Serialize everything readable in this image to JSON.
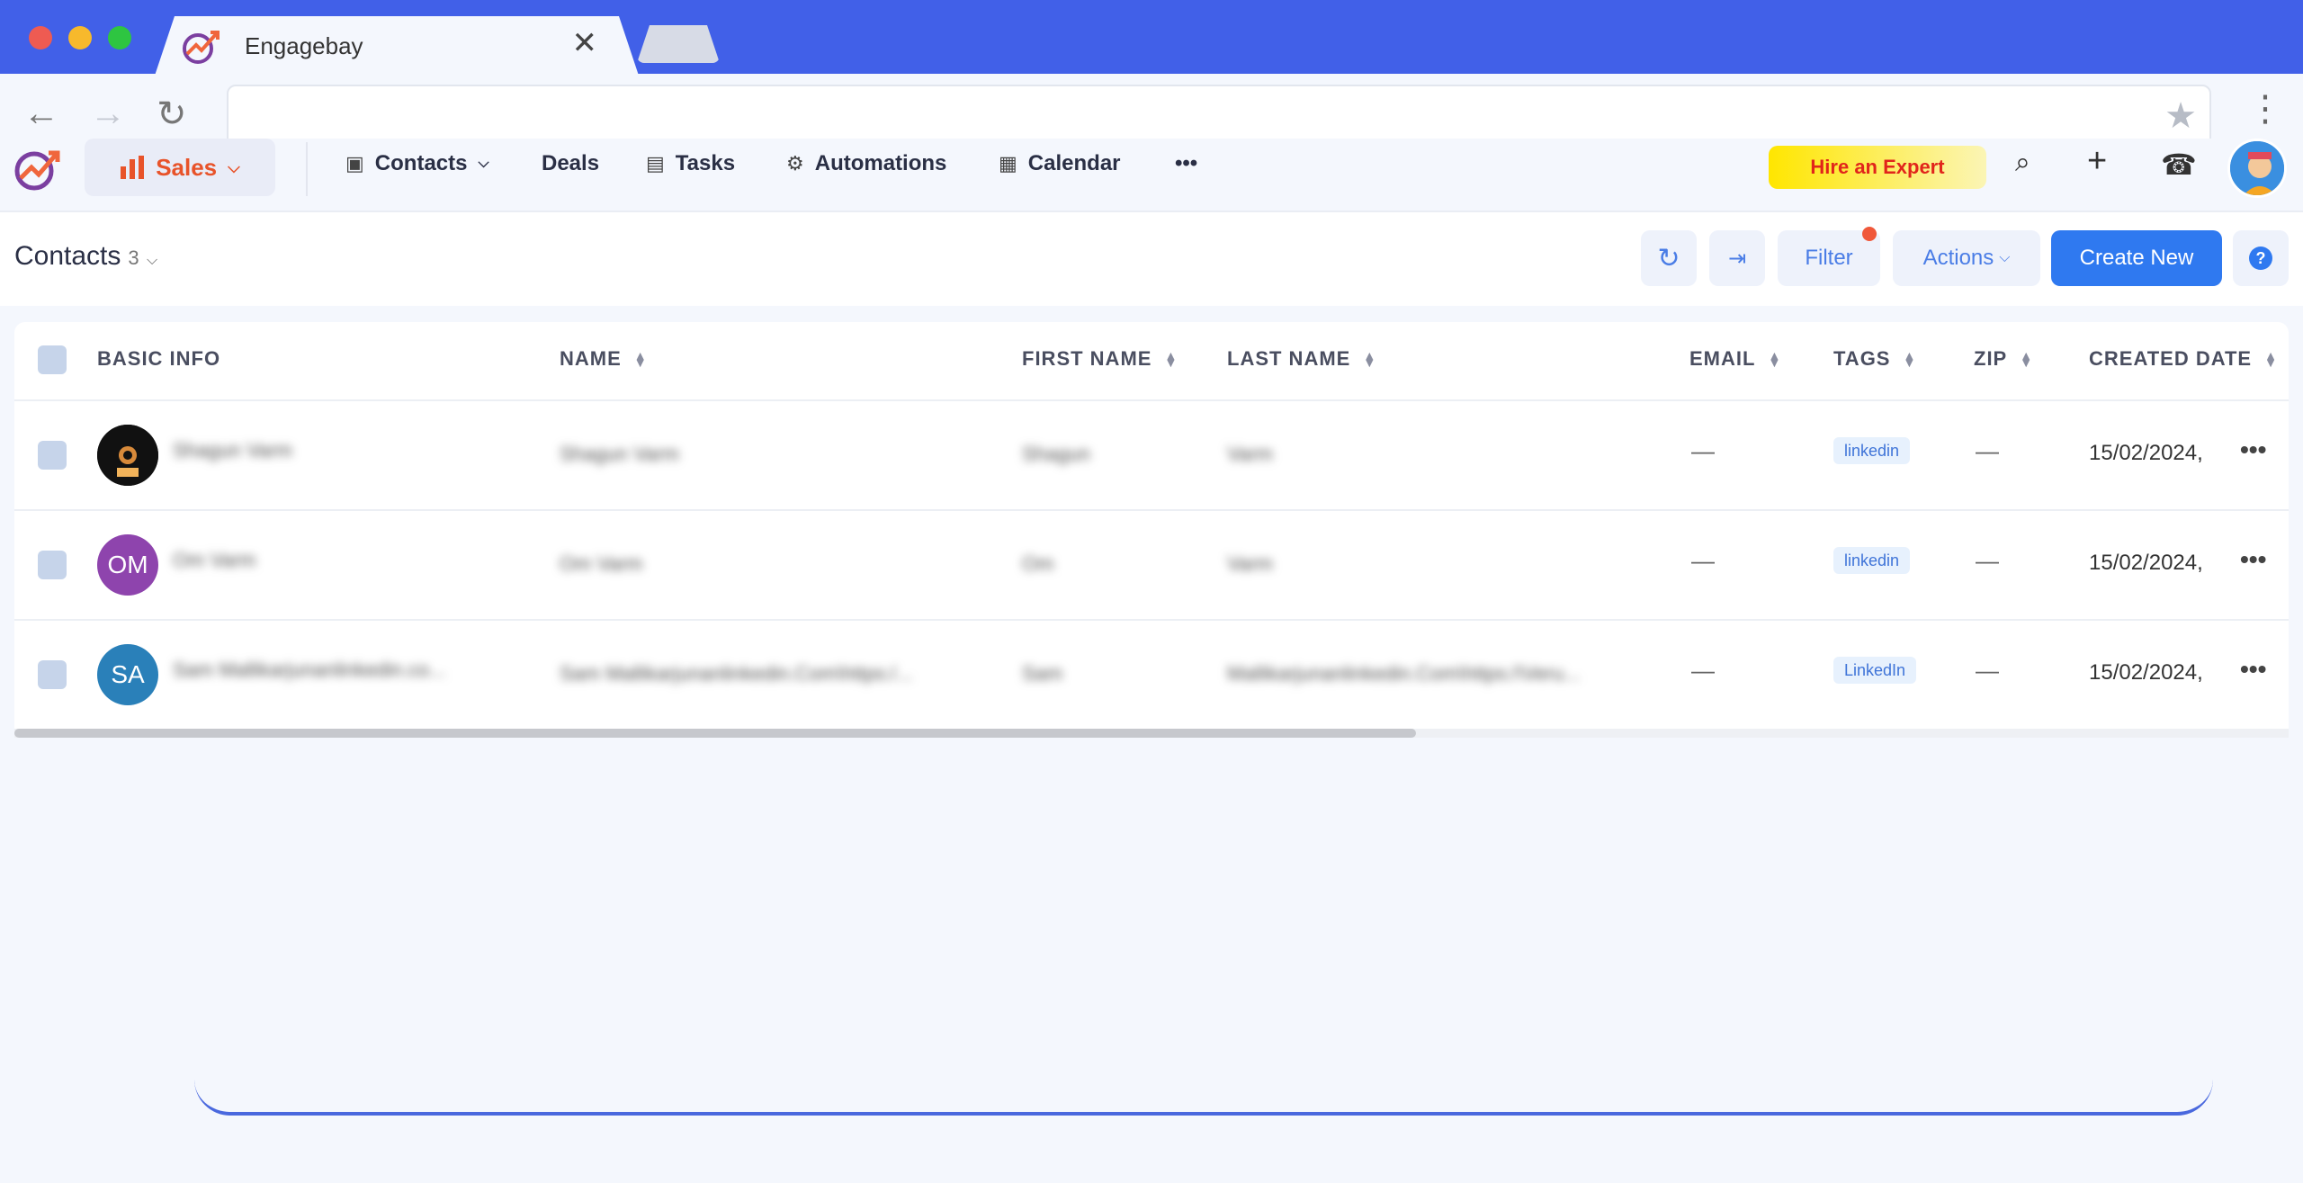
{
  "browser": {
    "tab_title": "Engagebay",
    "close_glyph": "✕",
    "back_glyph": "←",
    "forward_glyph": "→",
    "reload_glyph": "↻",
    "star_glyph": "★",
    "menu_glyph": "⋮",
    "traffic_colors": [
      "#ee5b52",
      "#f7b92c",
      "#2ec541"
    ]
  },
  "appnav": {
    "module": "Sales",
    "items": [
      {
        "label": "Contacts",
        "icon": "contacts-icon"
      },
      {
        "label": "Deals"
      },
      {
        "label": "Tasks",
        "icon": "tasks-icon"
      },
      {
        "label": "Automations",
        "icon": "gear-icon"
      },
      {
        "label": "Calendar",
        "icon": "calendar-icon"
      }
    ],
    "more": "•••",
    "hire_label": "Hire an Expert"
  },
  "subheader": {
    "title": "Contacts",
    "count": "3",
    "filter_label": "Filter",
    "actions_label": "Actions",
    "create_label": "Create New",
    "help_glyph": "?"
  },
  "table": {
    "columns": [
      "BASIC INFO",
      "NAME",
      "FIRST NAME",
      "LAST NAME",
      "EMAIL",
      "TAGS",
      "ZIP",
      "CREATED DATE"
    ],
    "rows": [
      {
        "initials": "",
        "avatar_color": "#1a1a1a",
        "basic": "Shagun Varm",
        "name": "Shagun Varm",
        "first": "Shagun",
        "last": "Varm",
        "email": "—",
        "tag": "linkedin",
        "zip": "—",
        "created": "15/02/2024,"
      },
      {
        "initials": "OM",
        "avatar_color": "#8e44ad",
        "basic": "Om Varm",
        "name": "Om Varm",
        "first": "Om",
        "last": "Varm",
        "email": "—",
        "tag": "linkedin",
        "zip": "—",
        "created": "15/02/2024,"
      },
      {
        "initials": "SA",
        "avatar_color": "#2a80b9",
        "basic": "Sam Mallikarjunanlinkedin.co...",
        "name": "Sam Mallikarjunanlinkedin.Com\\https:/...",
        "first": "Sam",
        "last": "Mallikarjunanlinkedin.Com\\https:/\\Veru...",
        "email": "—",
        "tag": "LinkedIn",
        "zip": "—",
        "created": "15/02/2024,"
      }
    ]
  },
  "colors": {
    "brand_blue": "#4160e8",
    "primary_button": "#2f79f0",
    "sales_orange": "#e8532a",
    "hire_red": "#e1251b"
  }
}
